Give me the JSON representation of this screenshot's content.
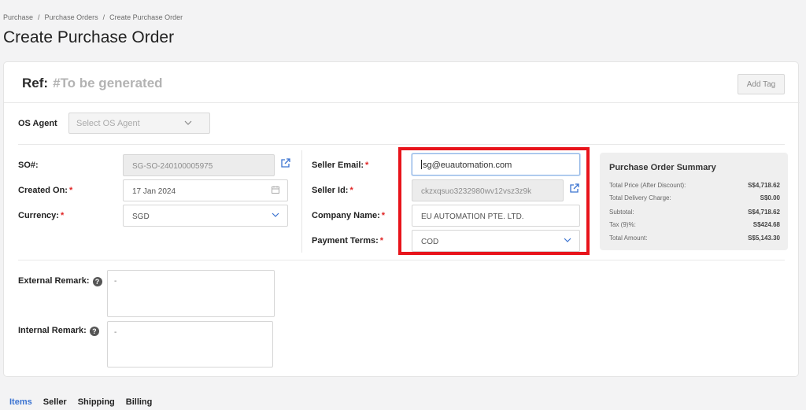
{
  "breadcrumb": [
    "Purchase",
    "Purchase Orders",
    "Create Purchase Order"
  ],
  "page_title": "Create Purchase Order",
  "ref": {
    "label": "Ref:",
    "value": "#To be generated"
  },
  "add_tag_label": "Add Tag",
  "os_agent": {
    "label": "OS Agent",
    "placeholder": "Select OS Agent"
  },
  "left_fields": {
    "so": {
      "label": "SO#:",
      "value": "SG-SO-240100005975"
    },
    "created_on": {
      "label": "Created On:",
      "value": "17 Jan 2024"
    },
    "currency": {
      "label": "Currency:",
      "value": "SGD"
    }
  },
  "seller_fields": {
    "email": {
      "label": "Seller Email:",
      "value": "sg@euautomation.com"
    },
    "seller_id": {
      "label": "Seller Id:",
      "value": "ckzxqsuo3232980wv12vsz3z9k"
    },
    "company": {
      "label": "Company Name:",
      "value": "EU AUTOMATION PTE. LTD."
    },
    "payment": {
      "label": "Payment Terms:",
      "value": "COD"
    }
  },
  "required_mark": "*",
  "summary": {
    "title": "Purchase Order Summary",
    "rows": [
      {
        "label": "Total Price (After Discount):",
        "value": "S$4,718.62"
      },
      {
        "label": "Total Delivery Charge:",
        "value": "S$0.00"
      },
      {
        "label": "Subtotal:",
        "value": "S$4,718.62"
      },
      {
        "label": "Tax (9)%:",
        "value": "S$424.68"
      },
      {
        "label": "Total Amount:",
        "value": "S$5,143.30"
      }
    ]
  },
  "remarks": {
    "external": {
      "label": "External Remark:",
      "value": "-"
    },
    "internal": {
      "label": "Internal Remark:",
      "value": "-"
    },
    "help_glyph": "?"
  },
  "tabs": [
    "Items",
    "Seller",
    "Shipping",
    "Billing"
  ],
  "colors": {
    "accent": "#3b73d1",
    "highlight": "#e8141b",
    "required": "#e02424"
  },
  "icons": [
    "external-link-icon",
    "calendar-icon",
    "chevron-down-icon",
    "help-icon"
  ]
}
